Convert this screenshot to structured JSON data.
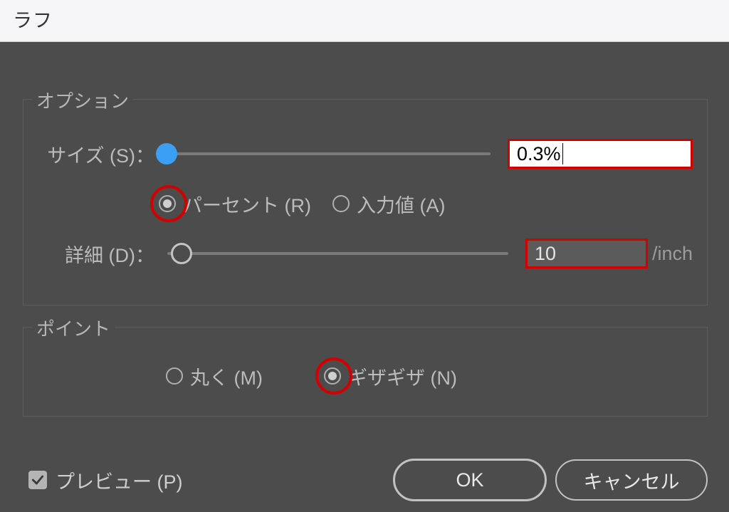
{
  "dialog": {
    "title": "ラフ"
  },
  "options": {
    "group_label": "オプション",
    "size_label": "サイズ (S)：",
    "size_value": "0.3%",
    "size_slider_pos_percent": 2,
    "mode": {
      "percent_label": "パーセント (R)",
      "absolute_label": "入力値 (A)",
      "selected": "percent"
    },
    "detail_label": "詳細 (D)：",
    "detail_value": "10",
    "detail_suffix": "/inch",
    "detail_slider_pos_percent": 6
  },
  "points": {
    "group_label": "ポイント",
    "round_label": "丸く (M)",
    "corner_label": "ギザギザ (N)",
    "selected": "corner"
  },
  "footer": {
    "preview_label": "プレビュー (P)",
    "preview_checked": true,
    "ok_label": "OK",
    "cancel_label": "キャンセル"
  }
}
